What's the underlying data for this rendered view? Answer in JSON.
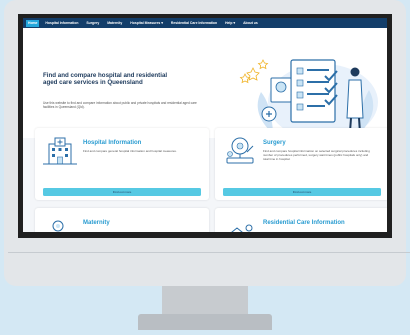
{
  "nav": {
    "items": [
      "Home",
      "Hospital Information",
      "Surgery",
      "Maternity",
      "Hospital Measures ▾",
      "Residential Care Information",
      "Help ▾",
      "About us"
    ],
    "active_index": 0
  },
  "hero": {
    "title": "Find and compare hospital and residential aged care services in Queensland",
    "subtitle": "Use this website to find and compare information about public and private hospitals and residential aged care facilities in Queensland (Qld)."
  },
  "cards": [
    {
      "title": "Hospital Information",
      "desc": "Find and compare general hospital information and hospital measures.",
      "button": "Find out more",
      "icon": "hospital-icon"
    },
    {
      "title": "Surgery",
      "desc": "Find and compare hospital information on selected surgical procedures including number of procedures performed, surgery wait times (public hospitals only) and total time in hospital.",
      "button": "Find out more",
      "icon": "surgery-icon"
    },
    {
      "title": "Maternity",
      "desc": "",
      "button": "",
      "icon": "maternity-icon"
    },
    {
      "title": "Residential Care Information",
      "desc": "",
      "button": "",
      "icon": "residential-care-icon"
    }
  ],
  "colors": {
    "nav": "#133e6a",
    "active": "#25a8dc",
    "accent": "#2a9cd1",
    "button": "#56c9e3"
  }
}
